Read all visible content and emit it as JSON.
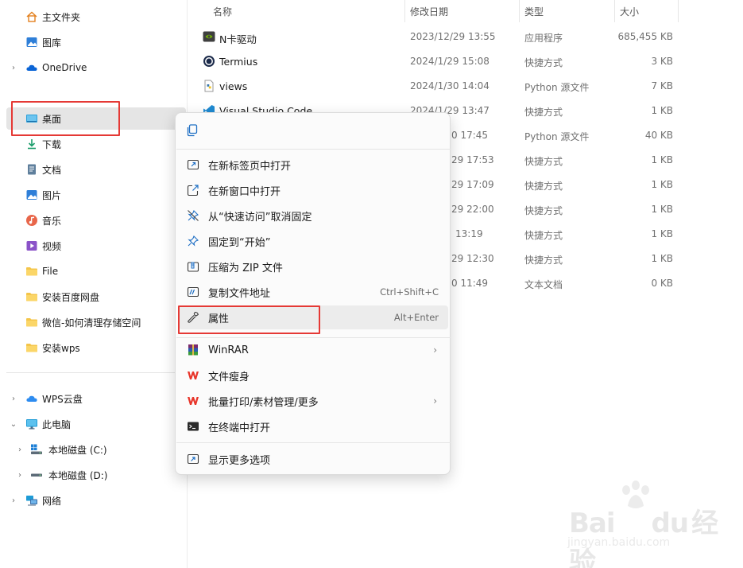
{
  "sidebar": {
    "items": [
      {
        "label": "主文件夹",
        "icon": "home-icon"
      },
      {
        "label": "图库",
        "icon": "gallery-icon"
      },
      {
        "label": "OneDrive",
        "icon": "cloud-icon"
      },
      {
        "label": "桌面",
        "icon": "desktop-icon"
      },
      {
        "label": "下载",
        "icon": "download-icon"
      },
      {
        "label": "文档",
        "icon": "document-icon"
      },
      {
        "label": "图片",
        "icon": "pictures-icon"
      },
      {
        "label": "音乐",
        "icon": "music-icon"
      },
      {
        "label": "视频",
        "icon": "video-icon"
      },
      {
        "label": "File",
        "icon": "folder-icon"
      },
      {
        "label": "安装百度网盘",
        "icon": "folder-icon"
      },
      {
        "label": "微信-如何清理存储空间",
        "icon": "folder-icon"
      },
      {
        "label": "安装wps",
        "icon": "folder-icon"
      },
      {
        "label": "WPS云盘",
        "icon": "cloud-icon"
      },
      {
        "label": "此电脑",
        "icon": "computer-icon"
      },
      {
        "label": "本地磁盘 (C:)",
        "icon": "windows-drive-icon"
      },
      {
        "label": "本地磁盘 (D:)",
        "icon": "drive-icon"
      },
      {
        "label": "网络",
        "icon": "network-icon"
      }
    ]
  },
  "filelist": {
    "columns": {
      "name": "名称",
      "modified": "修改日期",
      "type": "类型",
      "size": "大小"
    },
    "rows": [
      {
        "name": "N卡驱动",
        "modified": "2023/12/29 13:55",
        "type": "应用程序",
        "size": "685,455 KB",
        "icon": "nvidia-icon"
      },
      {
        "name": "Termius",
        "modified": "2024/1/29 15:08",
        "type": "快捷方式",
        "size": "3 KB",
        "icon": "termius-icon"
      },
      {
        "name": "views",
        "modified": "2024/1/30 14:04",
        "type": "Python 源文件",
        "size": "7 KB",
        "icon": "python-file-icon"
      },
      {
        "name": "Visual Studio Code",
        "modified": "2024/1/29 13:47",
        "type": "快捷方式",
        "size": "1 KB",
        "icon": "vscode-icon"
      },
      {
        "name": "",
        "modified": "0 17:45",
        "type": "Python 源文件",
        "size": "40 KB"
      },
      {
        "name": "",
        "modified": "29 17:53",
        "type": "快捷方式",
        "size": "1 KB"
      },
      {
        "name": "",
        "modified": "29 17:09",
        "type": "快捷方式",
        "size": "1 KB"
      },
      {
        "name": "",
        "modified": "29 22:00",
        "type": "快捷方式",
        "size": "1 KB"
      },
      {
        "name": "",
        "modified": "13:19",
        "type": "快捷方式",
        "size": "1 KB"
      },
      {
        "name": "",
        "modified": "29 12:30",
        "type": "快捷方式",
        "size": "1 KB"
      },
      {
        "name": "",
        "modified": "0 11:49",
        "type": "文本文档",
        "size": "0 KB"
      }
    ]
  },
  "context_menu": {
    "top_icon": "copy-icon",
    "items": [
      {
        "label": "在新标签页中打开",
        "icon": "open-new-tab-icon"
      },
      {
        "label": "在新窗口中打开",
        "icon": "open-new-window-icon"
      },
      {
        "label": "从“快速访问”取消固定",
        "icon": "unpin-icon"
      },
      {
        "label": "固定到“开始”",
        "icon": "pin-icon"
      },
      {
        "label": "压缩为 ZIP 文件",
        "icon": "zip-icon"
      },
      {
        "label": "复制文件地址",
        "icon": "copy-path-icon",
        "shortcut": "Ctrl+Shift+C"
      },
      {
        "label": "属性",
        "icon": "wrench-icon",
        "shortcut": "Alt+Enter"
      },
      {
        "label": "WinRAR",
        "icon": "winrar-icon"
      },
      {
        "label": "文件瘦身",
        "icon": "wps-icon"
      },
      {
        "label": "批量打印/素材管理/更多",
        "icon": "wps-icon"
      },
      {
        "label": "在终端中打开",
        "icon": "terminal-icon"
      },
      {
        "label": "显示更多选项",
        "icon": "more-options-icon"
      }
    ]
  },
  "watermark": {
    "brand": "Bai",
    "brand2": "du",
    "cn": "经验",
    "url": "jingyan.baidu.com"
  },
  "colors": {
    "highlight": "#e53935",
    "accent": "#0078d4",
    "wps_red": "#e8352a"
  }
}
